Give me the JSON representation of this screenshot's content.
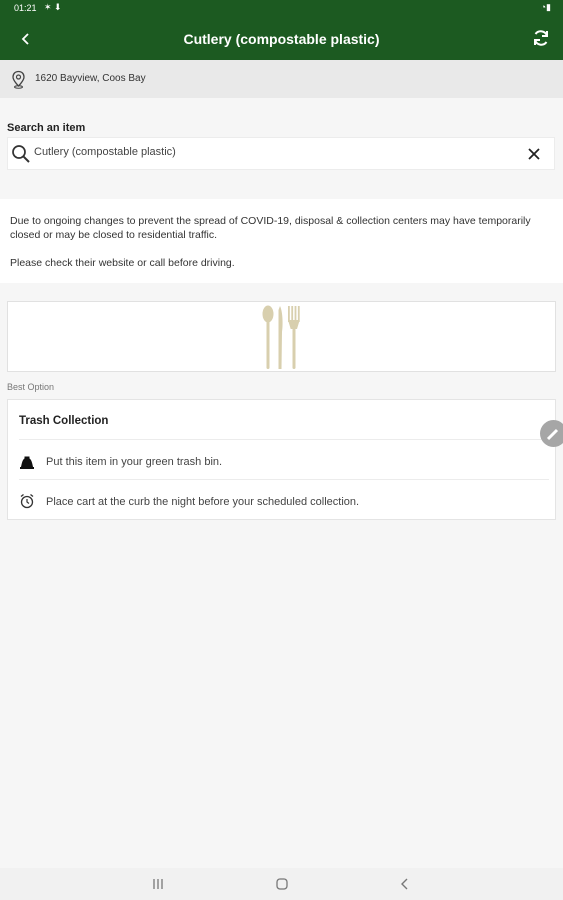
{
  "status_bar": {
    "time": "01:21",
    "left_icons": "✶ ⬇",
    "right_icons": "◔▮"
  },
  "header": {
    "title": "Cutlery (compostable plastic)",
    "back_icon": "back-arrow-icon",
    "refresh_icon": "refresh-icon"
  },
  "location": {
    "address": "1620 Bayview, Coos Bay",
    "icon": "location-pin-icon"
  },
  "search": {
    "label": "Search an item",
    "value": "Cutlery (compostable plastic)",
    "icon": "search-icon",
    "clear_icon": "close-icon"
  },
  "notice": {
    "paragraphs": [
      "Due to ongoing changes to prevent the spread of COVID-19, disposal & collection centers may have temporarily closed or may be closed to residential traffic.",
      "Please check their website or call before driving."
    ]
  },
  "item_image": {
    "icon": "cutlery-icon"
  },
  "best_option": {
    "label": "Best Option",
    "title": "Trash Collection",
    "rows": [
      {
        "icon": "trash-bin-icon",
        "text": "Put this item in your green trash bin."
      },
      {
        "icon": "alarm-clock-icon",
        "text": "Place cart at the curb the night before your scheduled collection."
      }
    ]
  },
  "colors": {
    "header_bg": "#1c5a21",
    "background": "#f6f6f6",
    "cutlery": "#d8cfae"
  }
}
